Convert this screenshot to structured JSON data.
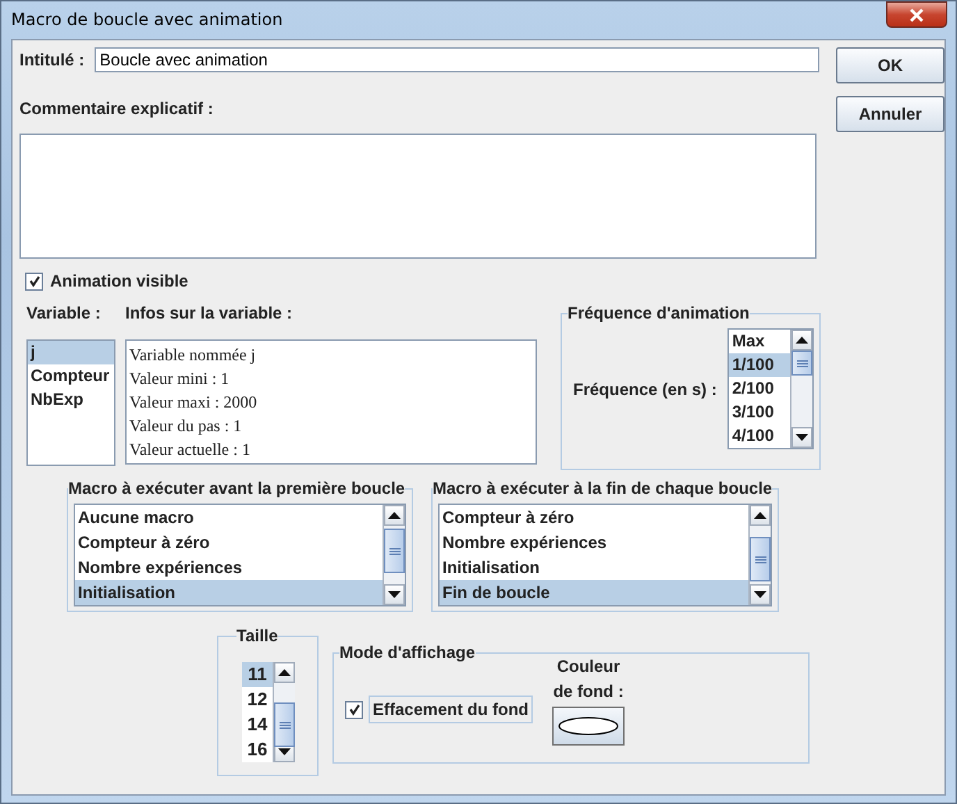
{
  "window": {
    "title": "Macro de boucle avec animation"
  },
  "title_field": {
    "label": "Intitulé :",
    "value": "Boucle avec animation"
  },
  "comment": {
    "label": "Commentaire explicatif :"
  },
  "animation_visible": {
    "label": "Animation visible",
    "checked": true
  },
  "variable": {
    "label": "Variable :",
    "items": [
      {
        "text": "j",
        "selected": true
      },
      {
        "text": "Compteur",
        "selected": false
      },
      {
        "text": "NbExp",
        "selected": false
      }
    ]
  },
  "info": {
    "label": "Infos sur la variable :",
    "lines": [
      "Variable nommée j",
      "Valeur mini : 1",
      "Valeur maxi : 2000",
      "Valeur du pas : 1",
      "Valeur actuelle : 1"
    ]
  },
  "frequency": {
    "title": "Fréquence d'animation",
    "label": "Fréquence (en s) :",
    "items": [
      {
        "text": "Max",
        "selected": false
      },
      {
        "text": "1/100",
        "selected": true
      },
      {
        "text": "2/100",
        "selected": false
      },
      {
        "text": "3/100",
        "selected": false
      },
      {
        "text": "4/100",
        "selected": false
      }
    ]
  },
  "macro_before": {
    "title": "Macro à exécuter avant la première boucle",
    "items": [
      {
        "text": "Aucune macro",
        "selected": false
      },
      {
        "text": "Compteur à zéro",
        "selected": false
      },
      {
        "text": "Nombre expériences",
        "selected": false
      },
      {
        "text": "Initialisation",
        "selected": true
      }
    ]
  },
  "macro_after": {
    "title": "Macro à exécuter à la fin de chaque boucle",
    "items": [
      {
        "text": "Compteur à zéro",
        "selected": false
      },
      {
        "text": "Nombre expériences",
        "selected": false
      },
      {
        "text": "Initialisation",
        "selected": false
      },
      {
        "text": "Fin de boucle",
        "selected": true
      }
    ]
  },
  "size": {
    "title": "Taille",
    "items": [
      {
        "text": "11",
        "selected": true
      },
      {
        "text": "12",
        "selected": false
      },
      {
        "text": "14",
        "selected": false
      },
      {
        "text": "16",
        "selected": false
      }
    ]
  },
  "display_mode": {
    "title": "Mode d'affichage",
    "clear_background": {
      "label": "Effacement du fond",
      "checked": true
    },
    "color_label": "Couleur de fond :"
  },
  "buttons": [
    {
      "label": "OK"
    },
    {
      "label": "Annuler"
    }
  ]
}
